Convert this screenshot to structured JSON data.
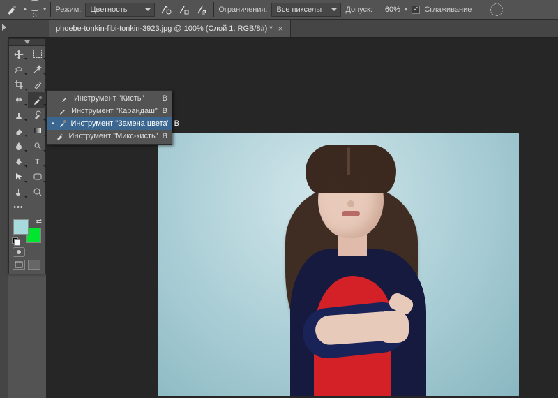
{
  "options_bar": {
    "brush_size": "3",
    "mode_label": "Режим:",
    "mode_value": "Цветность",
    "limits_label": "Ограничения:",
    "limits_value": "Все пикселы",
    "tolerance_label": "Допуск:",
    "tolerance_value": "60%",
    "antialias_label": "Сглаживание",
    "antialias_checked": "✓"
  },
  "tab": {
    "title": "phoebe-tonkin-fibi-tonkin-3923.jpg @ 100% (Слой 1, RGB/8#) *",
    "close": "×"
  },
  "flyout": {
    "items": [
      {
        "label": "Инструмент \"Кисть\"",
        "shortcut": "B",
        "active": false
      },
      {
        "label": "Инструмент \"Карандаш\"",
        "shortcut": "B",
        "active": false
      },
      {
        "label": "Инструмент \"Замена цвета\"",
        "shortcut": "B",
        "active": true
      },
      {
        "label": "Инструмент \"Микс-кисть\"",
        "shortcut": "B",
        "active": false
      }
    ]
  },
  "tools": {
    "left_col": [
      "move",
      "lasso",
      "crop",
      "spot-heal",
      "clone",
      "eraser",
      "blur",
      "pen",
      "path-sel",
      "hand"
    ],
    "right_col": [
      "marquee",
      "magic-wand",
      "eyedropper",
      "brush",
      "history-brush",
      "gradient",
      "dodge",
      "type",
      "shape",
      "zoom"
    ],
    "extra": "more",
    "masks": "quickmask"
  },
  "colors": {
    "fore": "#a8d9dd",
    "back": "#00e62e"
  }
}
